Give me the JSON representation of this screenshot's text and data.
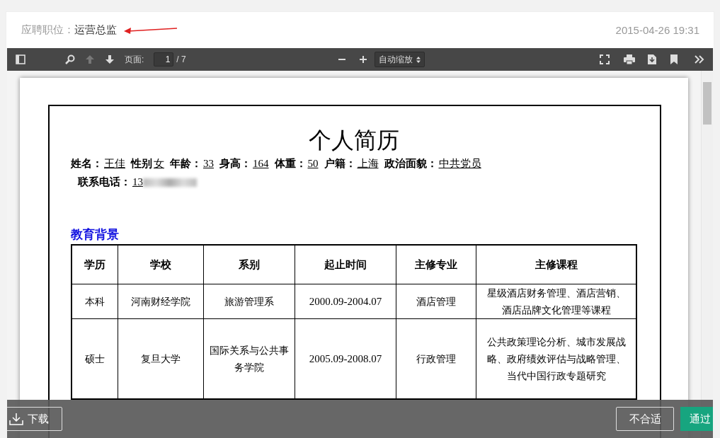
{
  "header": {
    "label": "应聘职位：",
    "position": "运营总监",
    "timestamp": "2015-04-26 19:31"
  },
  "toolbar": {
    "page_label": "页面:",
    "page_value": "1",
    "page_total": "/ 7",
    "zoom": "自动缩放",
    "prev_disabled": true
  },
  "resume": {
    "title": "个人简历",
    "fields": [
      {
        "label": "姓名：",
        "value": "王佳"
      },
      {
        "label": "性别",
        "value": "女"
      },
      {
        "label": "年龄：",
        "value": "33"
      },
      {
        "label": "身高：",
        "value": "164"
      },
      {
        "label": "体重：",
        "value": "50"
      },
      {
        "label": "户籍：",
        "value": "上海"
      },
      {
        "label": "政治面貌：",
        "value": "中共党员"
      },
      {
        "label": "联系电话：",
        "value": "13"
      }
    ],
    "section": "教育背景",
    "table": {
      "columns": [
        "学历",
        "学校",
        "系别",
        "起止时间",
        "主修专业",
        "主修课程"
      ],
      "rows": [
        [
          "本科",
          "河南财经学院",
          "旅游管理系",
          "2000.09-2004.07",
          "酒店管理",
          "星级酒店财务管理、酒店营销、酒店品牌文化管理等课程"
        ],
        [
          "硕士",
          "复旦大学",
          "国际关系与公共事务学院",
          "2005.09-2008.07",
          "行政管理",
          "公共政策理论分析、城市发展战略、政府绩效评估与战略管理、当代中国行政专题研究"
        ]
      ]
    }
  },
  "footer": {
    "download": "下载",
    "reject": "不合适",
    "accept": "通过"
  }
}
